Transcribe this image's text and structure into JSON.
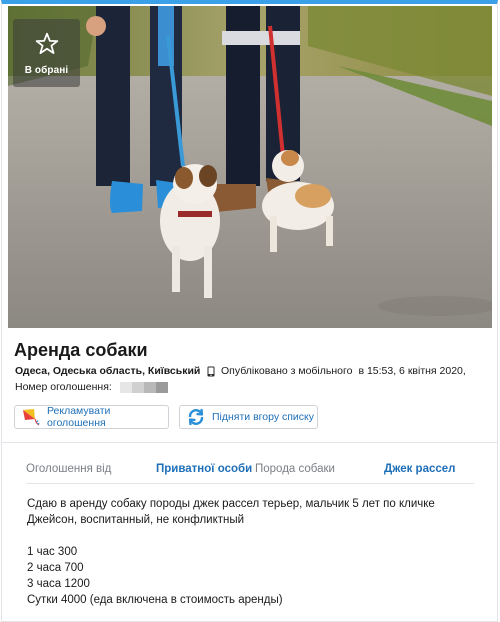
{
  "favorite": {
    "label": "В обрані",
    "icon": "star-icon"
  },
  "listing": {
    "title": "Аренда собаки",
    "location": "Одеса, Одеська область, Київський",
    "published": {
      "icon": "mobile-phone-icon",
      "prefix": "Опубліковано з мобільного",
      "timestamp": "в 15:53, 6 квітня 2020,"
    },
    "id_label": "Номер оголошення:"
  },
  "actions": {
    "promote": {
      "label": "Рекламувати оголошення",
      "icon": "kite-icon"
    },
    "raise": {
      "label": "Підняти вгору списку",
      "icon": "refresh-arrows-icon"
    }
  },
  "attributes": [
    {
      "key": "Оголошення від",
      "value": "Приватної особи"
    },
    {
      "key": "Порода собаки",
      "value": "Джек рассел"
    }
  ],
  "description": {
    "intro": [
      "Сдаю в аренду собаку породы джек рассел терьер, мальчик 5 лет по кличке",
      "Джейсон, воспитанный, не конфликтный"
    ],
    "prices": [
      "1 час 300",
      "2 часа 700",
      "3 часа 1200",
      "Сутки 4000 (еда включена в стоимость аренды)"
    ]
  },
  "colors": {
    "accent": "#1f6fb8",
    "top_border": "#3aa0e8",
    "muted": "#7a7f86"
  }
}
